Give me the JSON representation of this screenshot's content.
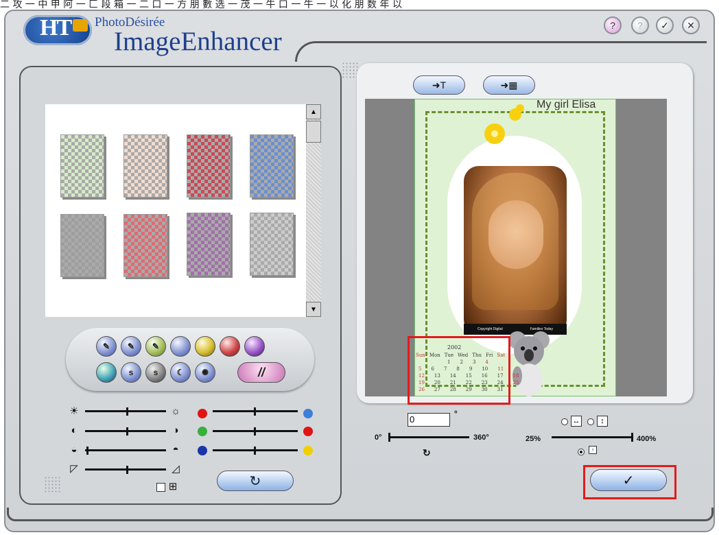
{
  "top_strip_text": "二 攻 一 中 甲 阿 一 匚 段 箱 一 二 口 一 方 朋 數 选 一 茂 一 牛 口 一 牛 一 以 化 朋 数 年 以",
  "app": {
    "brand_small": "PhotoDésirée",
    "brand_big": "ImageEnhancer",
    "logo_text": "HT",
    "title_buttons": [
      "?",
      "?",
      "✓",
      "✕"
    ]
  },
  "preview": {
    "card_title": "My girl Elisa",
    "caption_left": "Copyright Digital",
    "caption_right": "Families Today",
    "calendar": {
      "year": "2002",
      "days": [
        "Sun",
        "Mon",
        "Tue",
        "Wed",
        "Thu",
        "Fri",
        "Sat"
      ],
      "weeks": [
        [
          "",
          "",
          "",
          "1",
          "2",
          "3",
          "4"
        ],
        [
          "5",
          "6",
          "7",
          "8",
          "9",
          "10",
          "11"
        ],
        [
          "12",
          "13",
          "14",
          "15",
          "16",
          "17",
          "18"
        ],
        [
          "19",
          "20",
          "21",
          "22",
          "23",
          "24",
          "25"
        ],
        [
          "26",
          "27",
          "28",
          "29",
          "30",
          "31",
          ""
        ]
      ]
    }
  },
  "rotation": {
    "value": "0",
    "degree_symbol": "°",
    "min_label": "0°",
    "max_label": "360°",
    "value_fraction": 0.0
  },
  "zoom": {
    "min_label": "25%",
    "max_label": "400%",
    "value_fraction": 1.0
  },
  "sliders": [
    {
      "name": "brightness",
      "fraction": 0.5
    },
    {
      "name": "contrast",
      "fraction": 0.5
    },
    {
      "name": "gamma",
      "fraction": 0.0
    },
    {
      "name": "sharpness",
      "fraction": 0.5
    },
    {
      "name": "red-cyan",
      "fraction": 0.5
    },
    {
      "name": "green-red",
      "fraction": 0.5
    },
    {
      "name": "blue-yellow",
      "fraction": 0.5
    }
  ],
  "colors": {
    "red": "#e01414",
    "green": "#38b03a",
    "blue": "#1a35a8",
    "light_blue": "#3b7fd6",
    "yellow": "#f0d000",
    "highlight": "#e21b1b"
  },
  "buttons": {
    "ok": "✓",
    "reset": "↻",
    "effect_wide": "//"
  },
  "effect_icons": [
    "s",
    "s"
  ]
}
